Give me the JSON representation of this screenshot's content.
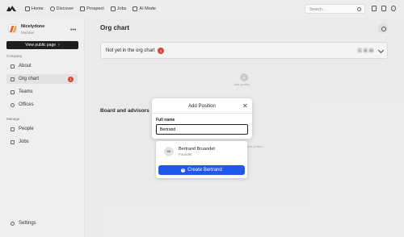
{
  "topnav": {
    "items": [
      {
        "label": "Home",
        "icon": "home-icon"
      },
      {
        "label": "Discover",
        "icon": "globe-icon"
      },
      {
        "label": "Prospect",
        "icon": "filter-icon"
      },
      {
        "label": "Jobs",
        "icon": "briefcase-icon"
      },
      {
        "label": "AI Mode",
        "icon": "sparkle-icon"
      }
    ],
    "search_placeholder": "Search..."
  },
  "sidebar": {
    "org_name": "Nicelydone",
    "org_role": "Member",
    "public_page_button": "View public page",
    "company_section": "Company",
    "company_items": [
      {
        "label": "About"
      },
      {
        "label": "Org chart",
        "badge": "1",
        "active": true
      },
      {
        "label": "Teams"
      },
      {
        "label": "Offices"
      }
    ],
    "manage_section": "Manage",
    "manage_items": [
      {
        "label": "People"
      },
      {
        "label": "Jobs"
      }
    ],
    "settings_label": "Settings"
  },
  "main": {
    "title": "Org chart",
    "not_in_chart_label": "Not yet in the org chart",
    "not_in_chart_count": "1",
    "avatar_initials": [
      "L",
      "B",
      "JG"
    ],
    "add_label": "Add position",
    "board_title": "Board and advisors"
  },
  "modal": {
    "title": "Add Position",
    "field_label": "Full name",
    "field_value": "Bertrand",
    "suggestion_initials": "BB",
    "suggestion_name": "Bertrand Bruandet",
    "suggestion_role": "Founder",
    "create_button": "Create Bertrand"
  },
  "colors": {
    "accent": "#2058e8",
    "badge": "#d94636",
    "dark_button": "#1e1e1e"
  }
}
